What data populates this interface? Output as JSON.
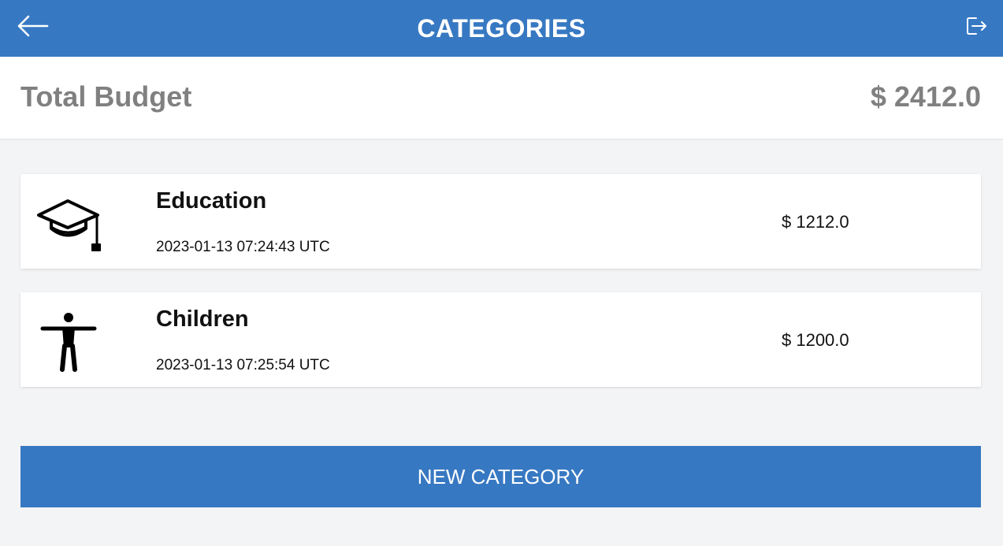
{
  "header": {
    "title": "CATEGORIES",
    "back_icon": "arrow-left-icon",
    "logout_icon": "logout-icon",
    "background_color": "#3778c2"
  },
  "budget": {
    "label": "Total Budget",
    "value": "$ 2412.0"
  },
  "categories": [
    {
      "name": "Education",
      "date": "2023-01-13 07:24:43 UTC",
      "amount": "$ 1212.0",
      "icon": "graduation-cap-icon"
    },
    {
      "name": "Children",
      "date": "2023-01-13 07:25:54 UTC",
      "amount": "$ 1200.0",
      "icon": "person-icon"
    }
  ],
  "actions": {
    "new_category_label": "NEW CATEGORY",
    "button_color": "#3778c2"
  }
}
